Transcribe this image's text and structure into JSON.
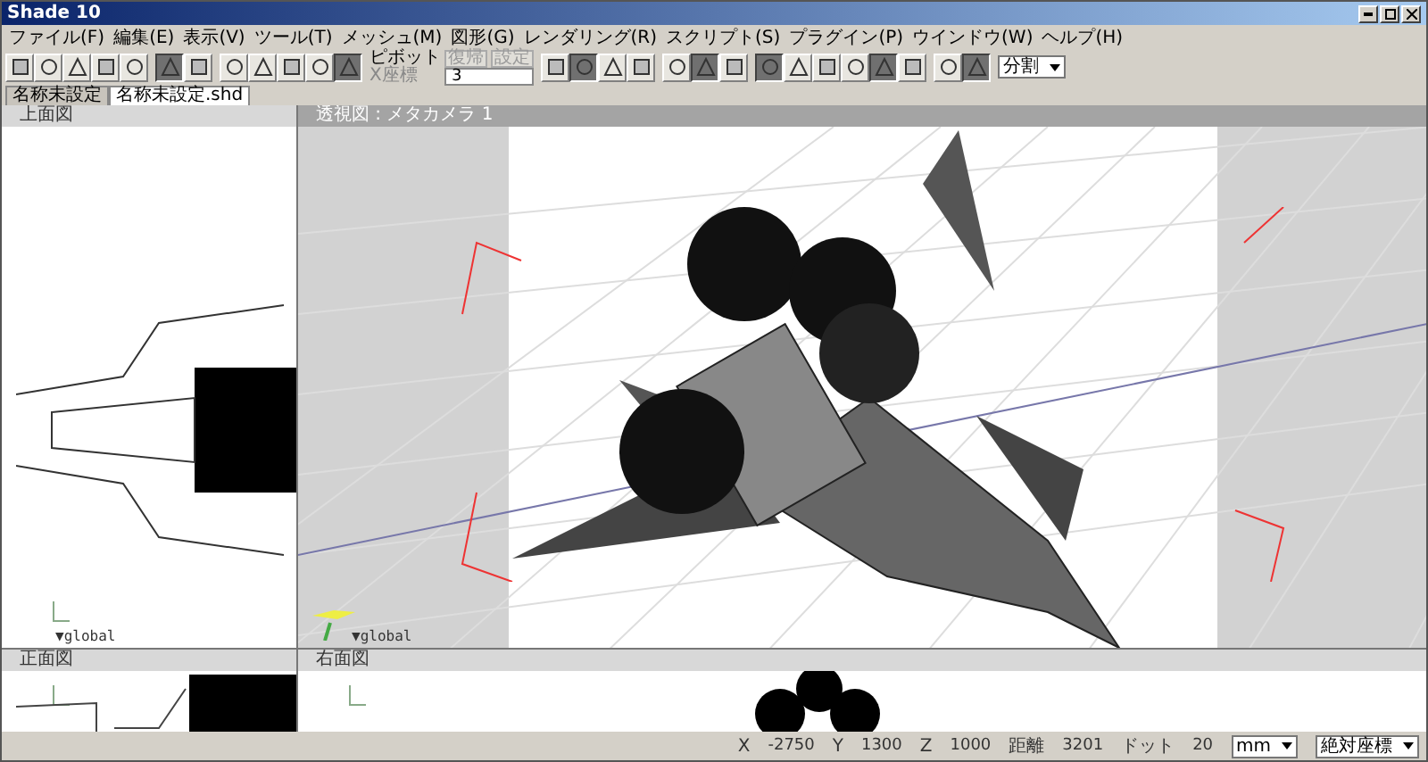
{
  "window": {
    "title": "Shade 10"
  },
  "menu": [
    "ファイル(F)",
    "編集(E)",
    "表示(V)",
    "ツール(T)",
    "メッシュ(M)",
    "図形(G)",
    "レンダリング(R)",
    "スクリプト(S)",
    "プラグイン(P)",
    "ウインドウ(W)",
    "ヘルプ(H)"
  ],
  "toolbar": {
    "groups": [
      [
        {
          "pressed": false
        },
        {
          "pressed": false
        },
        {
          "pressed": false
        },
        {
          "pressed": false
        },
        {
          "pressed": false
        }
      ],
      [
        {
          "pressed": true
        },
        {
          "pressed": false
        }
      ],
      [
        {
          "pressed": false
        },
        {
          "pressed": false
        },
        {
          "pressed": false
        },
        {
          "pressed": false
        },
        {
          "pressed": true
        }
      ],
      [
        {
          "pressed": false
        },
        {
          "pressed": true
        },
        {
          "pressed": false
        },
        {
          "pressed": false
        }
      ],
      [
        {
          "pressed": false
        },
        {
          "pressed": true
        },
        {
          "pressed": false
        }
      ],
      [
        {
          "pressed": true
        },
        {
          "pressed": false
        },
        {
          "pressed": false
        },
        {
          "pressed": false
        },
        {
          "pressed": true
        },
        {
          "pressed": false
        }
      ],
      [
        {
          "pressed": false
        },
        {
          "pressed": true
        }
      ]
    ],
    "pivot": {
      "label": "ピボット",
      "buttons": [
        "復帰",
        "設定"
      ],
      "axis_label": "X座標",
      "value": "3"
    },
    "split": "分割"
  },
  "tabs": [
    {
      "label": "名称未設定",
      "selected": false
    },
    {
      "label": "名称未設定.shd",
      "selected": true
    }
  ],
  "viewports": [
    {
      "kind": "top",
      "title": "上面図",
      "label": "▼global"
    },
    {
      "kind": "perspective",
      "title": "透視図 : メタカメラ 1",
      "label": "▼global"
    },
    {
      "kind": "front",
      "title": "正面図"
    },
    {
      "kind": "right",
      "title": "右面図"
    }
  ],
  "status_bar": {
    "fields": [
      {
        "label": "X",
        "value": "-2750"
      },
      {
        "label": "Y",
        "value": "1300"
      },
      {
        "label": "Z",
        "value": "1000"
      },
      {
        "label": "距離",
        "value": "3201"
      },
      {
        "label": "ドット",
        "value": "20"
      }
    ],
    "unit": "mm",
    "coords": "絶対座標"
  }
}
